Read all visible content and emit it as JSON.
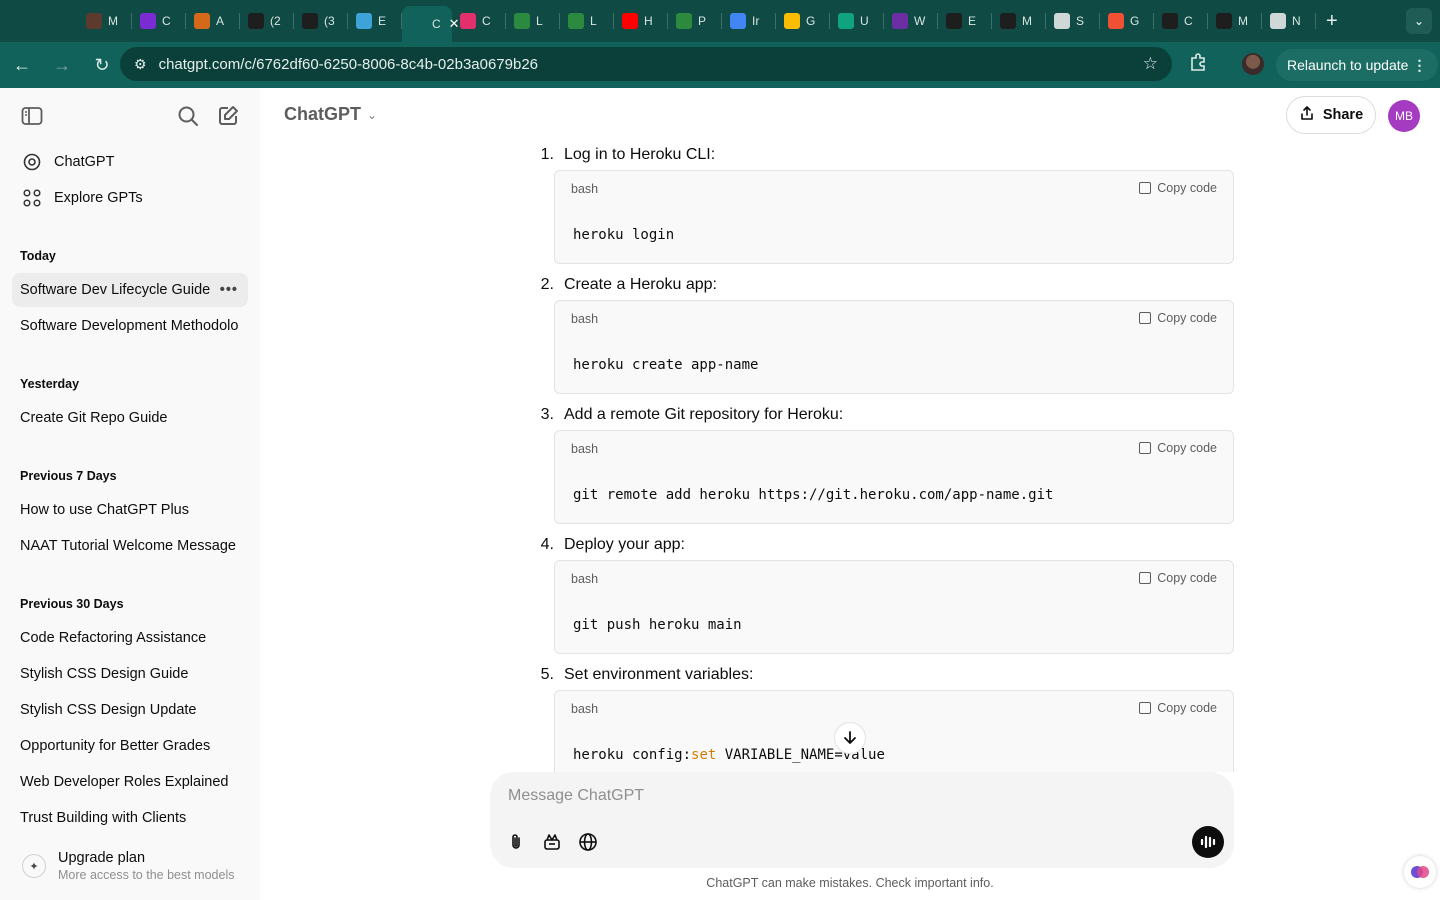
{
  "browser": {
    "tabs": [
      {
        "letter": "M",
        "color": "#5c3b2e"
      },
      {
        "letter": "C",
        "color": "#7a2bd1"
      },
      {
        "letter": "A",
        "color": "#d4691a"
      },
      {
        "letter": "(2",
        "color": "#1e1e1e"
      },
      {
        "letter": "(3",
        "color": "#1e1e1e"
      },
      {
        "letter": "E",
        "color": "#3da3d8"
      },
      {
        "letter": "C",
        "color": "#ffffff",
        "active": true
      },
      {
        "letter": "C",
        "color": "#e1306c"
      },
      {
        "letter": "L",
        "color": "#2b8a3e"
      },
      {
        "letter": "L",
        "color": "#2b8a3e"
      },
      {
        "letter": "H",
        "color": "#ff0000"
      },
      {
        "letter": "P",
        "color": "#2b8a3e"
      },
      {
        "letter": "Ir",
        "color": "#4285f4"
      },
      {
        "letter": "G",
        "color": "#fbbc04"
      },
      {
        "letter": "U",
        "color": "#10a37f"
      },
      {
        "letter": "W",
        "color": "#6b2fa3"
      },
      {
        "letter": "E",
        "color": "#1e1e1e"
      },
      {
        "letter": "M",
        "color": "#1e1e1e"
      },
      {
        "letter": "S",
        "color": "#cfd8d6"
      },
      {
        "letter": "G",
        "color": "#f05033"
      },
      {
        "letter": "C",
        "color": "#1e1e1e"
      },
      {
        "letter": "M",
        "color": "#1e1e1e"
      },
      {
        "letter": "N",
        "color": "#cfd8d6"
      }
    ],
    "url": "chatgpt.com/c/6762df60-6250-8006-8c4b-02b3a0679b26",
    "relaunch_label": "Relaunch to update"
  },
  "sidebar": {
    "nav": [
      {
        "label": "ChatGPT"
      },
      {
        "label": "Explore GPTs"
      }
    ],
    "sections": [
      {
        "heading": "Today",
        "items": [
          "Software Dev Lifecycle Guide",
          "Software Development Methodolo"
        ]
      },
      {
        "heading": "Yesterday",
        "items": [
          "Create Git Repo Guide"
        ]
      },
      {
        "heading": "Previous 7 Days",
        "items": [
          "How to use ChatGPT Plus",
          "NAAT Tutorial Welcome Message"
        ]
      },
      {
        "heading": "Previous 30 Days",
        "items": [
          "Code Refactoring Assistance",
          "Stylish CSS Design Guide",
          "Stylish CSS Design Update",
          "Opportunity for Better Grades",
          "Web Developer Roles Explained",
          "Trust Building with Clients"
        ]
      }
    ],
    "upgrade": {
      "title": "Upgrade plan",
      "subtitle": "More access to the best models"
    }
  },
  "header": {
    "model": "ChatGPT",
    "share_label": "Share",
    "avatar_initials": "MB"
  },
  "conversation": {
    "steps": [
      {
        "number": "1.",
        "text": "Log in to Heroku CLI:",
        "lang": "bash",
        "copy_label": "Copy code",
        "code": "heroku login"
      },
      {
        "number": "2.",
        "text": "Create a Heroku app:",
        "lang": "bash",
        "copy_label": "Copy code",
        "code": "heroku create app-name"
      },
      {
        "number": "3.",
        "text": "Add a remote Git repository for Heroku:",
        "lang": "bash",
        "copy_label": "Copy code",
        "code": "git remote add heroku https://git.heroku.com/app-name.git"
      },
      {
        "number": "4.",
        "text": "Deploy your app:",
        "lang": "bash",
        "copy_label": "Copy code",
        "code": "git push heroku main"
      },
      {
        "number": "5.",
        "text": "Set environment variables:",
        "lang": "bash",
        "copy_label": "Copy code",
        "code_parts": [
          "heroku config:",
          "set",
          " VARIABLE_NAME=value"
        ]
      }
    ]
  },
  "composer": {
    "placeholder": "Message ChatGPT",
    "value": ""
  },
  "footer": {
    "disclaimer": "ChatGPT can make mistakes. Check important info."
  }
}
